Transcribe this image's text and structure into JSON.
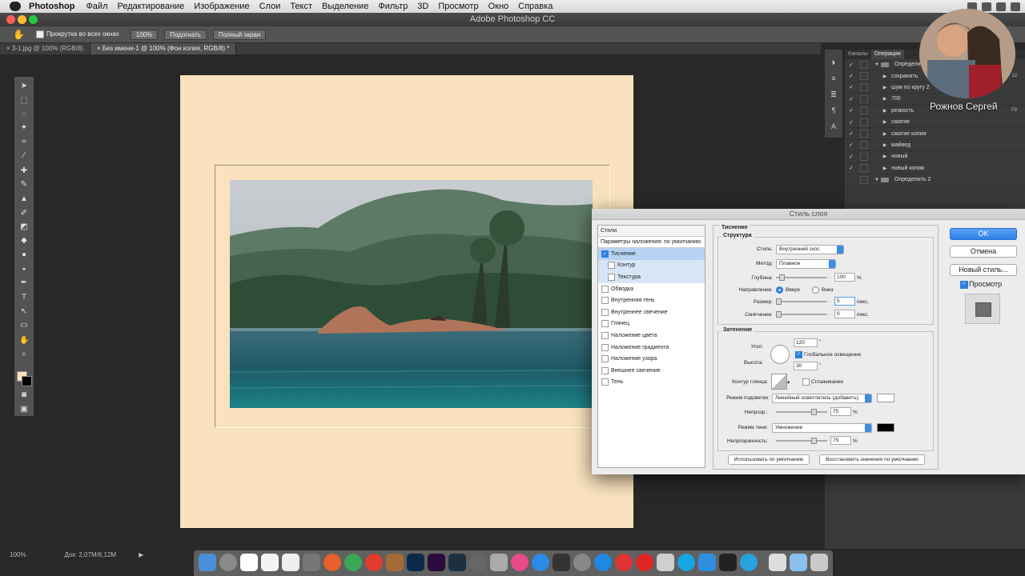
{
  "menubar": {
    "app_name": "Photoshop",
    "items": [
      "Файл",
      "Редактирование",
      "Изображение",
      "Слои",
      "Текст",
      "Выделение",
      "Фильтр",
      "3D",
      "Просмотр",
      "Окно",
      "Справка"
    ]
  },
  "window": {
    "title": "Adobe Photoshop CC"
  },
  "options_bar": {
    "scroll_all_label": "Прокрутка во всех окнах",
    "zoom_btn": "100%",
    "fit_btn": "Подогнать",
    "fullscreen_btn": "Полный экран"
  },
  "doc_tabs": [
    {
      "label": "3-1.jpg @ 100% (RGB/8)"
    },
    {
      "label": "Без имени-1 @ 100% (Фон копия, RGB/8) *"
    }
  ],
  "status_bar": {
    "zoom": "100%",
    "doc_size": "Док: 2,07M/6,12M"
  },
  "actions_panel": {
    "tabs": [
      "Каналы",
      "Операции"
    ],
    "rows": [
      {
        "label": "Определить",
        "type": "set",
        "key": ""
      },
      {
        "label": "сохранить",
        "type": "action",
        "key": "12"
      },
      {
        "label": "шум по кругу 2",
        "type": "action",
        "key": ""
      },
      {
        "label": "700",
        "type": "action",
        "key": ""
      },
      {
        "label": "резкость",
        "type": "action",
        "key": "F8"
      },
      {
        "label": "сжатие",
        "type": "action",
        "key": ""
      },
      {
        "label": "сжатие копия",
        "type": "action",
        "key": ""
      },
      {
        "label": "майвед",
        "type": "action",
        "key": ""
      },
      {
        "label": "новый",
        "type": "action",
        "key": ""
      },
      {
        "label": "новый копия",
        "type": "action",
        "key": ""
      },
      {
        "label": "Определить 2",
        "type": "set",
        "key": ""
      }
    ]
  },
  "overlay": {
    "name": "Рожнов Сергей"
  },
  "dialog": {
    "title": "Стиль слоя",
    "styles_header": "Стили",
    "blend_default": "Параметры наложения: по умолчанию",
    "style_items": [
      {
        "label": "Тиснение",
        "checked": true,
        "level": 0,
        "state": "selected"
      },
      {
        "label": "Контур",
        "checked": false,
        "level": 1,
        "state": "sub"
      },
      {
        "label": "Текстура",
        "checked": false,
        "level": 1,
        "state": "sub"
      },
      {
        "label": "Обводка",
        "checked": false,
        "level": 0,
        "state": ""
      },
      {
        "label": "Внутренняя тень",
        "checked": false,
        "level": 0,
        "state": ""
      },
      {
        "label": "Внутреннее свечение",
        "checked": false,
        "level": 0,
        "state": ""
      },
      {
        "label": "Глянец",
        "checked": false,
        "level": 0,
        "state": ""
      },
      {
        "label": "Наложение цвета",
        "checked": false,
        "level": 0,
        "state": ""
      },
      {
        "label": "Наложение градиента",
        "checked": false,
        "level": 0,
        "state": ""
      },
      {
        "label": "Наложение узора",
        "checked": false,
        "level": 0,
        "state": ""
      },
      {
        "label": "Внешнее свечение",
        "checked": false,
        "level": 0,
        "state": ""
      },
      {
        "label": "Тень",
        "checked": false,
        "level": 0,
        "state": ""
      }
    ],
    "section_title": "Тиснение",
    "structure": {
      "group_label": "Структура",
      "style_label": "Стиль:",
      "style_value": "Внутренний скос",
      "method_label": "Метод:",
      "method_value": "Плавное",
      "depth_label": "Глубина:",
      "depth_value": "100",
      "depth_unit": "%",
      "direction_label": "Направление:",
      "dir_up": "Вверх",
      "dir_down": "Вниз",
      "size_label": "Размер:",
      "size_value": "5",
      "size_unit": "пикс.",
      "soften_label": "Смягчение:",
      "soften_value": "0",
      "soften_unit": "пикс."
    },
    "shading": {
      "group_label": "Затенение",
      "angle_label": "Угол:",
      "angle_value": "120",
      "angle_unit": "°",
      "global_light": "Глобальное освещение",
      "altitude_label": "Высота:",
      "altitude_value": "30",
      "altitude_unit": "°",
      "gloss_label": "Контур глянца:",
      "antialias": "Сглаживание",
      "highlight_label": "Режим подсветки:",
      "highlight_value": "Линейный осветлитель (добавить)",
      "hl_opacity_label": "Непрозр.:",
      "hl_opacity_value": "75",
      "hl_opacity_unit": "%",
      "shadow_label": "Режим тени:",
      "shadow_value": "Умножение",
      "sh_opacity_label": "Непрозрачность:",
      "sh_opacity_value": "75",
      "sh_opacity_unit": "%"
    },
    "btn_use_default": "Использовать по умолчанию",
    "btn_reset_default": "Восстановить значения по умолчанию",
    "btn_ok": "OK",
    "btn_cancel": "Отмена",
    "btn_new_style": "Новый стиль...",
    "preview_label": "Просмотр"
  },
  "colors": {
    "canvas_bg": "#f9e2bd",
    "highlight_swatch": "#ffffff",
    "shadow_swatch": "#000000",
    "accent": "#2f7fe0"
  },
  "icons": [
    "apple-icon",
    "hand-icon",
    "move-icon",
    "marquee-icon",
    "lasso-icon",
    "magic-wand-icon",
    "crop-icon",
    "eyedropper-icon",
    "brush-icon",
    "stamp-icon",
    "eraser-icon",
    "bucket-icon",
    "dodge-icon",
    "pen-icon",
    "type-icon",
    "path-select-icon",
    "shape-icon",
    "zoom-icon"
  ]
}
